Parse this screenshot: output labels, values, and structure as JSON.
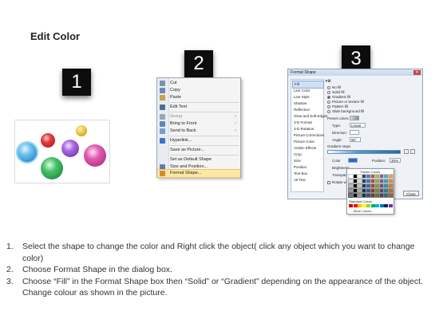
{
  "title": "Edit Color",
  "steps_labels": [
    "1",
    "2",
    "3"
  ],
  "panel1": {
    "balls": [
      {
        "name": "blue-ball",
        "color": "#3aa6e0"
      },
      {
        "name": "red-ball",
        "color": "#c8202a"
      },
      {
        "name": "purple-ball",
        "color": "#8a3fc8"
      },
      {
        "name": "yellow-ball",
        "color": "#e8b420"
      },
      {
        "name": "pink-ball",
        "color": "#d63a9a"
      },
      {
        "name": "green-ball",
        "color": "#2aa048"
      }
    ]
  },
  "context_menu": {
    "items": [
      {
        "label": "Cut",
        "icon": "scissors-icon",
        "color": "#7a8fb0",
        "submenu": false
      },
      {
        "label": "Copy",
        "icon": "copy-icon",
        "color": "#6d8ab5",
        "submenu": false
      },
      {
        "label": "Paste",
        "icon": "paste-icon",
        "color": "#c9a24a",
        "submenu": false
      },
      {
        "label": "Edit Text",
        "icon": "edit-text-icon",
        "color": "#4a6f9c",
        "submenu": false
      },
      {
        "label": "Group",
        "icon": "group-icon",
        "color": "#9aa5b5",
        "submenu": true
      },
      {
        "label": "Bring to Front",
        "icon": "bring-to-front-icon",
        "color": "#5a86c4",
        "submenu": true
      },
      {
        "label": "Send to Back",
        "icon": "send-to-back-icon",
        "color": "#7d9bc4",
        "submenu": true
      },
      {
        "label": "Hyperlink...",
        "icon": "hyperlink-icon",
        "color": "#3b73c7",
        "submenu": false
      },
      {
        "label": "Save as Picture...",
        "icon": "",
        "color": "",
        "submenu": false
      },
      {
        "label": "Set as Default Shape",
        "icon": "",
        "color": "",
        "submenu": false
      },
      {
        "label": "Size and Position...",
        "icon": "size-position-icon",
        "color": "#5c7fb2",
        "submenu": false
      },
      {
        "label": "Format Shape...",
        "icon": "format-shape-icon",
        "color": "#d98b2a",
        "submenu": false,
        "selected": true
      }
    ]
  },
  "dialog": {
    "title": "Format Shape",
    "close_glyph": "✕",
    "nav": [
      "Fill",
      "Line Color",
      "Line Style",
      "Shadow",
      "Reflection",
      "Glow and Soft Edges",
      "3-D Format",
      "3-D Rotation",
      "Picture Corrections",
      "Picture Color",
      "Artistic Effects",
      "Crop",
      "Size",
      "Position",
      "Text Box",
      "Alt Text"
    ],
    "fill_heading": "Fill",
    "options": [
      "No fill",
      "Solid fill",
      "Gradient fill",
      "Picture or texture fill",
      "Pattern fill",
      "Slide background fill"
    ],
    "preset_label": "Preset colors:",
    "type_label": "Type:",
    "type_value": "Linear",
    "direction_label": "Direction:",
    "angle_label": "Angle:",
    "angle_value": "90°",
    "stops_label": "Gradient stops",
    "color_label": "Color",
    "position_label": "Position:",
    "position_value": "30%",
    "brightness_label": "Brightness:",
    "transparency_label": "Transparency:",
    "rotate_label": "Rotate with shape",
    "palette_theme": "Theme Colors",
    "palette_standard": "Standard Colors",
    "palette_more": "More Colors...",
    "close_button": "Close"
  },
  "instructions": [
    {
      "num": "1.",
      "text": "Select the shape to change the color and Right click the object( click any object which you want to change color)"
    },
    {
      "num": "2.",
      "text": "Choose Format Shape in the dialog box."
    },
    {
      "num": "3.",
      "text": "Choose “Fill” in the Format Shape box then “Solid” or “Gradient” depending on the appearance of the object. Change colour as shown in the picture."
    }
  ]
}
